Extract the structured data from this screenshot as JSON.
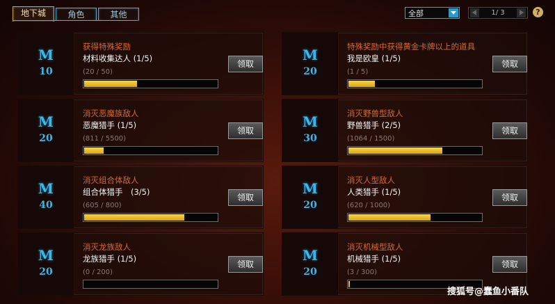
{
  "tabs": [
    {
      "label": "地下城"
    },
    {
      "label": "角色"
    },
    {
      "label": "其他"
    }
  ],
  "filter": {
    "selected": "全部"
  },
  "pager": {
    "text": "1/ 3"
  },
  "help_label": "?",
  "cards": [
    {
      "points": "10",
      "title": "获得特殊奖励",
      "subtitle": "材料收集达人 (1/5)",
      "progress_text": "(20 / 50)",
      "progress": 0.4,
      "button": "领取"
    },
    {
      "points": "20",
      "title": "特殊奖励中获得黄金卡牌以上的道具",
      "subtitle": "我是欧皇 (1/5)",
      "progress_text": "(1 / 5)",
      "progress": 0.2,
      "button": "领取"
    },
    {
      "points": "20",
      "title": "消灭恶魔族敌人",
      "subtitle": "恶魔猎手 (1/5)",
      "progress_text": "(811 / 5500)",
      "progress": 0.147,
      "button": "领取"
    },
    {
      "points": "30",
      "title": "消灭野兽型敌人",
      "subtitle": "野兽猎手 (2/5)",
      "progress_text": "(1064 / 1500)",
      "progress": 0.709,
      "button": "领取"
    },
    {
      "points": "40",
      "title": "消灭组合体敌人",
      "subtitle": "组合体猎手　(3/5)",
      "progress_text": "(605 / 800)",
      "progress": 0.756,
      "button": "领取"
    },
    {
      "points": "20",
      "title": "消灭人型敌人",
      "subtitle": "人类猎手 (1/5)",
      "progress_text": "(620 / 1000)",
      "progress": 0.62,
      "button": "领取"
    },
    {
      "points": "20",
      "title": "消灭龙族敌人",
      "subtitle": "龙族猎手 (1/5)",
      "progress_text": "(0 / 200)",
      "progress": 0,
      "button": "领取"
    },
    {
      "points": "20",
      "title": "消灭机械型敌人",
      "subtitle": "机械猎手 (1/5)",
      "progress_text": "(3 / 300)",
      "progress": 0.01,
      "button": "领取"
    }
  ],
  "watermark": "搜狐号@蠢鱼小番队",
  "colors": {
    "accent": "#3cb8e8",
    "title": "#d8682a",
    "bar": "#f0c83a"
  },
  "icons": {
    "prev": "chevron-left-icon",
    "next": "chevron-right-icon",
    "dropdown": "chevron-down-icon",
    "badge": "m-emblem-icon"
  }
}
